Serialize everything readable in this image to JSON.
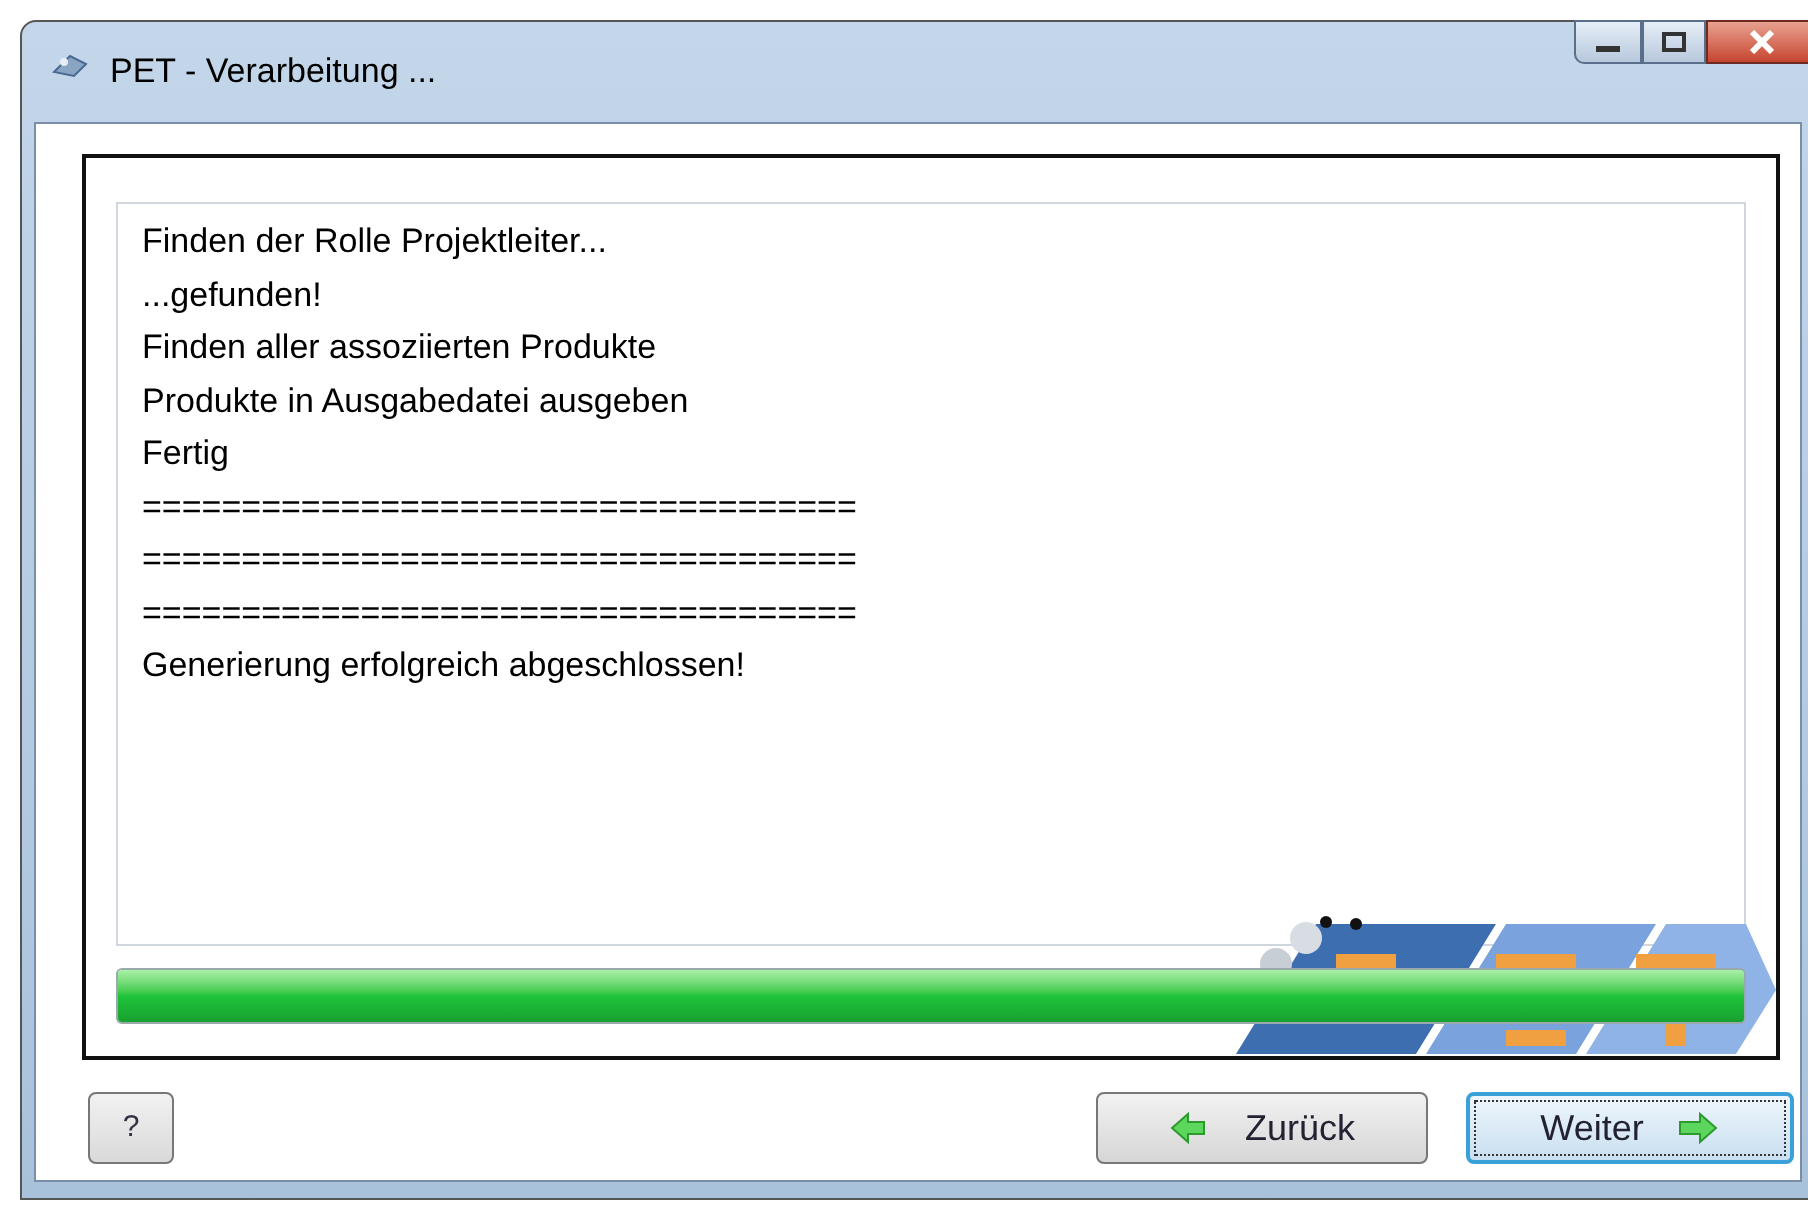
{
  "window": {
    "title": "PET - Verarbeitung ..."
  },
  "log": [
    "Finden der Rolle Projektleiter...",
    "...gefunden!",
    "Finden aller assoziierten Produkte",
    "Produkte in Ausgabedatei ausgeben",
    "Fertig",
    "====================================",
    "====================================",
    "====================================",
    "Generierung erfolgreich abgeschlossen!"
  ],
  "progress": {
    "level": 1
  },
  "help_button": {
    "label": "?"
  },
  "buttons": [
    {
      "label": "Zurück",
      "kind": "back",
      "focused": false
    },
    {
      "label": "Weiter",
      "kind": "next",
      "focused": true
    }
  ]
}
